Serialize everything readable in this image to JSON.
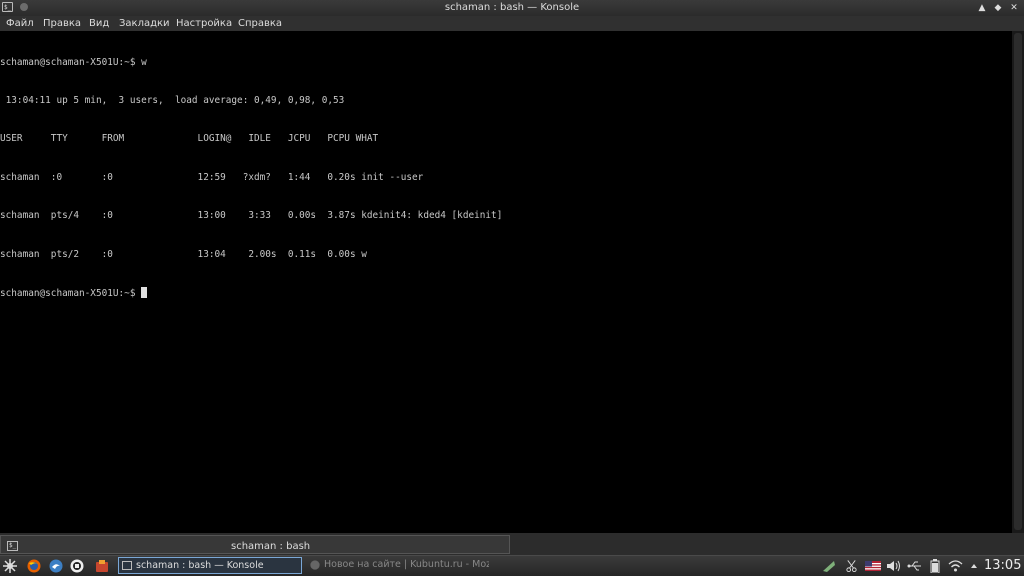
{
  "window": {
    "title": "schaman : bash — Konsole",
    "app_icon": "konsole-icon",
    "buttons": [
      "▲",
      "◆",
      "✕"
    ]
  },
  "menu": [
    "Файл",
    "Правка",
    "Вид",
    "Закладки",
    "Настройка",
    "Справка"
  ],
  "terminal": {
    "lines": [
      "schaman@schaman-X501U:~$ w",
      " 13:04:11 up 5 min,  3 users,  load average: 0,49, 0,98, 0,53",
      "USER     TTY      FROM             LOGIN@   IDLE   JCPU   PCPU WHAT",
      "schaman  :0       :0               12:59   ?xdm?   1:44   0.20s init --user",
      "schaman  pts/4    :0               13:00    3:33   0.00s  3.87s kdeinit4: kded4 [kdeinit]",
      "schaman  pts/2    :0               13:04    2.00s  0.11s  0.00s w"
    ],
    "prompt": "schaman@schaman-X501U:~$ "
  },
  "tabs": [
    {
      "label": "schaman : bash"
    }
  ],
  "taskbar": {
    "launchers": [
      "kickoff-icon",
      "firefox-icon",
      "dolphin-icon",
      "system-icon",
      "software-icon"
    ],
    "tasks": [
      {
        "label": "schaman : bash — Konsole",
        "active": true
      },
      {
        "label": "Новое на сайте | Kubuntu.ru - Mozilla Firefox",
        "active": false
      }
    ],
    "tray": [
      "network-manager-icon",
      "scissors-icon",
      "flag-icon",
      "volume-icon",
      "usb-icon",
      "battery-icon",
      "wifi-icon",
      "expand-icon"
    ],
    "clock": "13:05"
  }
}
